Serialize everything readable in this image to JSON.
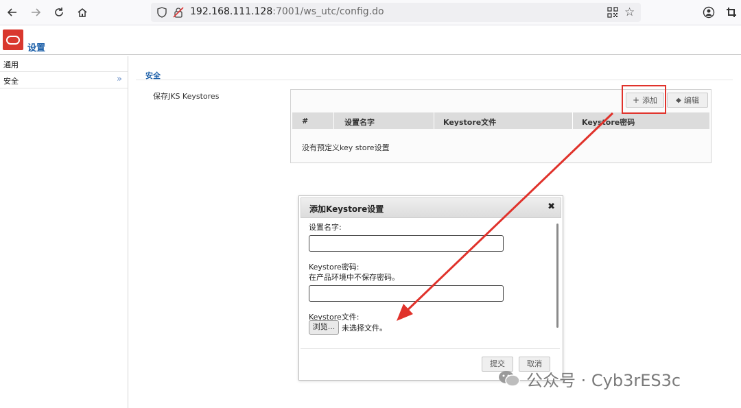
{
  "browser": {
    "url_host": "192.168.111.128",
    "url_rest": ":7001/ws_utc/config.do"
  },
  "app": {
    "title": "设置"
  },
  "sidebar": {
    "items": [
      {
        "label": "通用"
      },
      {
        "label": "安全"
      }
    ]
  },
  "main": {
    "section_title": "安全",
    "keystores_label": "保存JKS Keystores",
    "toolbar": {
      "add_label": "添加",
      "edit_label": "编辑"
    },
    "table": {
      "columns": [
        "#",
        "设置名字",
        "Keystore文件",
        "Keystore密码"
      ],
      "empty_text": "没有预定义key store设置"
    }
  },
  "dialog": {
    "title": "添加Keystore设置",
    "name_label": "设置名字:",
    "password_label": "Keystore密码:",
    "password_hint": "在产品环境中不保存密码。",
    "file_label": "Keystore文件:",
    "browse_label": "浏览...",
    "no_file_text": "未选择文件。",
    "submit_label": "提交",
    "cancel_label": "取消"
  },
  "watermark": {
    "text": "公众号 · Cyb3rES3c"
  },
  "colors": {
    "accent": "#1a5ea8",
    "highlight": "#e0322b",
    "logo": "#d9382e"
  }
}
